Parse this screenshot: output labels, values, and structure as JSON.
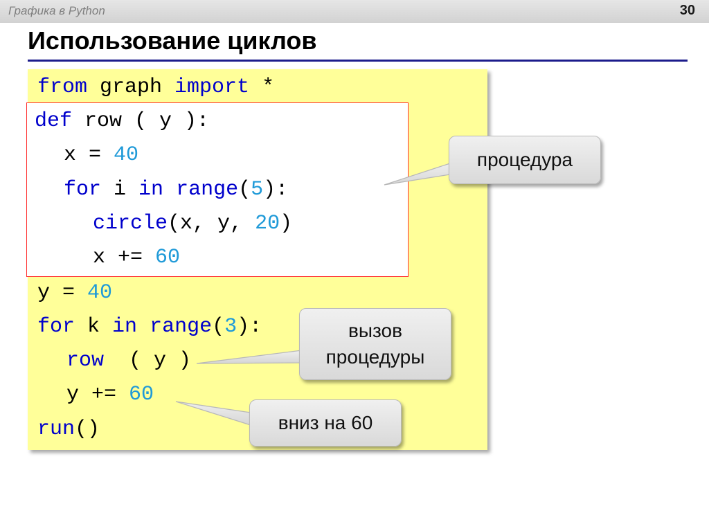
{
  "header": {
    "course": "Графика в Python",
    "page_number": "30"
  },
  "slide": {
    "title": "Использование циклов"
  },
  "code": {
    "l1_kw1": "from",
    "l1_mod": " graph ",
    "l1_kw2": "import",
    "l1_star": " *",
    "l2_kw": "def",
    "l2_rest": " row ( y ):",
    "l3_pre": "x = ",
    "l3_num": "40",
    "l4_kw1": "for",
    "l4_mid1": " i ",
    "l4_kw2": "in",
    "l4_sp": " ",
    "l4_fn": "range",
    "l4_open": "(",
    "l4_num": "5",
    "l4_close": "):",
    "l5_fn": "circle",
    "l5_mid": "(x, y, ",
    "l5_num": "20",
    "l5_close": ")",
    "l6_pre": "x += ",
    "l6_num": "60",
    "l7_pre": "y = ",
    "l7_num": "40",
    "l8_kw1": "for",
    "l8_mid1": " k ",
    "l8_kw2": "in",
    "l8_sp": " ",
    "l8_fn": "range",
    "l8_open": "(",
    "l8_num": "3",
    "l8_close": "):",
    "l9_fn": "row",
    "l9_rest": "  ( y )",
    "l10_pre": "y += ",
    "l10_num": "60",
    "l11_fn": "run",
    "l11_rest": "()"
  },
  "callouts": {
    "procedure": "процедура",
    "call_line1": "вызов",
    "call_line2": "процедуры",
    "down": "вниз на 60"
  },
  "colors": {
    "keyword": "#0000cc",
    "number": "#1f9ad8",
    "code_background": "#ffff99",
    "procedure_frame": "#ff2a2a",
    "title_rule": "#1c1c8c"
  }
}
